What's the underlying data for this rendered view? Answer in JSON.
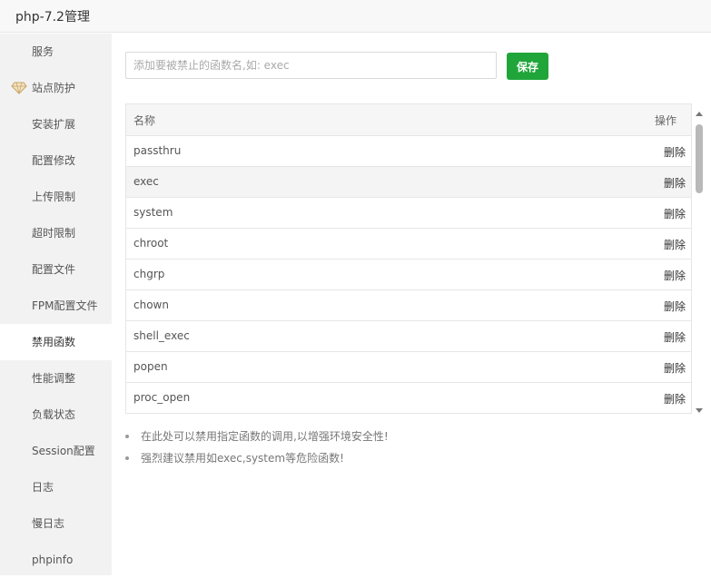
{
  "window": {
    "title": "php-7.2管理"
  },
  "sidebar": {
    "items": [
      {
        "label": "服务"
      },
      {
        "label": "站点防护",
        "icon": "gem-icon"
      },
      {
        "label": "安装扩展"
      },
      {
        "label": "配置修改"
      },
      {
        "label": "上传限制"
      },
      {
        "label": "超时限制"
      },
      {
        "label": "配置文件"
      },
      {
        "label": "FPM配置文件"
      },
      {
        "label": "禁用函数",
        "active": true
      },
      {
        "label": "性能调整"
      },
      {
        "label": "负载状态"
      },
      {
        "label": "Session配置"
      },
      {
        "label": "日志"
      },
      {
        "label": "慢日志"
      },
      {
        "label": "phpinfo"
      }
    ]
  },
  "form": {
    "input_placeholder": "添加要被禁止的函数名,如: exec",
    "input_value": "",
    "save_label": "保存"
  },
  "table": {
    "headers": {
      "name": "名称",
      "action": "操作"
    },
    "rows": [
      {
        "name": "passthru",
        "action": "删除"
      },
      {
        "name": "exec",
        "action": "删除"
      },
      {
        "name": "system",
        "action": "删除"
      },
      {
        "name": "chroot",
        "action": "删除"
      },
      {
        "name": "chgrp",
        "action": "删除"
      },
      {
        "name": "chown",
        "action": "删除"
      },
      {
        "name": "shell_exec",
        "action": "删除"
      },
      {
        "name": "popen",
        "action": "删除"
      },
      {
        "name": "proc_open",
        "action": "删除"
      }
    ]
  },
  "notes": [
    "在此处可以禁用指定函数的调用,以增强环境安全性!",
    "强烈建议禁用如exec,system等危险函数!"
  ],
  "colors": {
    "accent": "#20a53a",
    "sidebar_bg": "#f2f2f2"
  }
}
